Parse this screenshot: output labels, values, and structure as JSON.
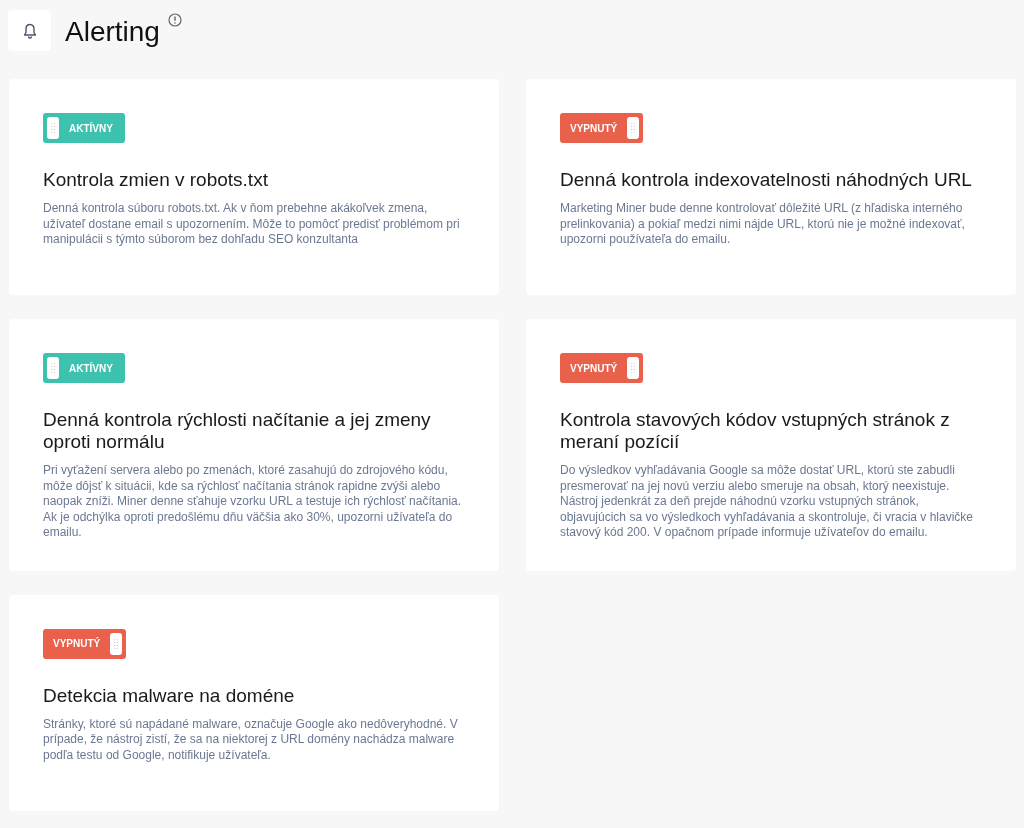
{
  "page": {
    "title": "Alerting"
  },
  "alerts": [
    {
      "status_label": "AKTÍVNY",
      "on": true,
      "title": "Kontrola zmien v robots.txt",
      "description": "Denná kontrola súboru robots.txt. Ak v ňom prebehne akákoľvek zmena, užívateľ dostane email s upozornením. Môže to pomôcť predisť problémom pri manipulácii s týmto súborom bez dohľadu SEO konzultanta"
    },
    {
      "status_label": "VYPNUTÝ",
      "on": false,
      "title": "Denná kontrola indexovatelnosti náhodných URL",
      "description": "Marketing Miner bude denne kontrolovať dôležité URL (z hľadiska interného prelinkovania) a pokiaľ medzi nimi nájde URL, ktorú nie je možné indexovať, upozorni používateľa do emailu."
    },
    {
      "status_label": "AKTÍVNY",
      "on": true,
      "title": "Denná kontrola rýchlosti načítanie a jej zmeny oproti normálu",
      "description": "Pri vyťažení servera alebo po zmenách, ktoré zasahujú do zdrojového kódu, môže dôjsť k situácii, kde sa rýchlosť načítania stránok rapidne zvýši alebo naopak zníži. Miner denne sťahuje vzorku URL a testuje ich rýchlosť načítania. Ak je odchýlka oproti predošlému dňu väčšia ako 30%, upozorni užívateľa do emailu."
    },
    {
      "status_label": "VYPNUTÝ",
      "on": false,
      "title": "Kontrola stavových kódov vstupných stránok z meraní pozícií",
      "description": "Do výsledkov vyhľadávania Google sa môže dostať URL, ktorú ste zabudli presmerovať na jej novú verziu alebo smeruje na obsah, ktorý neexistuje. Nástroj jedenkrát za deň prejde náhodnú vzorku vstupných stránok, objavujúcich sa vo výsledkoch vyhľadávania a skontroluje, či vracia v hlavičke stavový kód 200. V opačnom prípade informuje užívateľov do emailu."
    },
    {
      "status_label": "VYPNUTÝ",
      "on": false,
      "title": "Detekcia malware na doméne",
      "description": "Stránky, ktoré sú napádané malware, označuje Google ako nedôveryhodné. V prípade, že nástroj zistí, že sa na niektorej z URL domény nachádza malware podľa testu od Google, notifikuje užívateľa."
    }
  ]
}
